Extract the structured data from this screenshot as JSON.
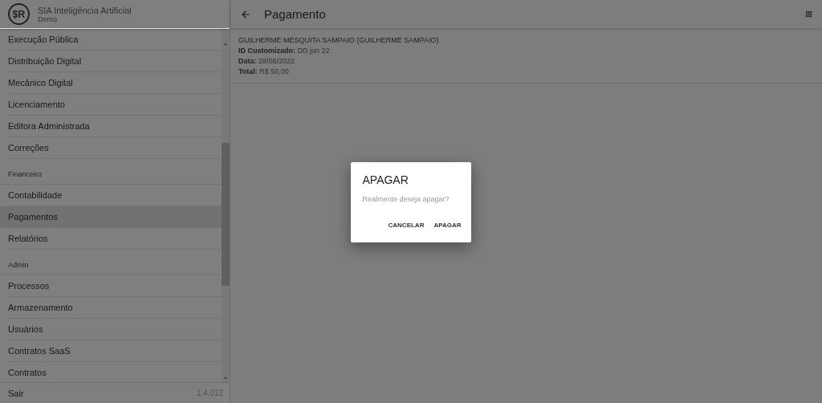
{
  "app": {
    "name": "SIA Inteligência Artificial",
    "subtitle": "Demo",
    "logo": "$R"
  },
  "menu": [
    {
      "kind": "item",
      "label": "Execução Pública",
      "selected": false
    },
    {
      "kind": "item",
      "label": "Distribuição Digital",
      "selected": false
    },
    {
      "kind": "item",
      "label": "Mecânico Digital",
      "selected": false
    },
    {
      "kind": "item",
      "label": "Licenciamento",
      "selected": false
    },
    {
      "kind": "item",
      "label": "Editora Administrada",
      "selected": false
    },
    {
      "kind": "item",
      "label": "Correções",
      "selected": false
    },
    {
      "kind": "heading",
      "label": "Financeiro"
    },
    {
      "kind": "item",
      "label": "Contabilidade",
      "selected": false
    },
    {
      "kind": "item",
      "label": "Pagamentos",
      "selected": true
    },
    {
      "kind": "item",
      "label": "Relatórios",
      "selected": false
    },
    {
      "kind": "heading",
      "label": "Admin"
    },
    {
      "kind": "item",
      "label": "Processos",
      "selected": false
    },
    {
      "kind": "item",
      "label": "Armazenamento",
      "selected": false
    },
    {
      "kind": "item",
      "label": "Usuários",
      "selected": false
    },
    {
      "kind": "item",
      "label": "Contratos SaaS",
      "selected": false
    },
    {
      "kind": "item",
      "label": "Contratos",
      "selected": false
    }
  ],
  "footer": {
    "logout": "Sair",
    "version": "1.4.012"
  },
  "page": {
    "title": "Pagamento"
  },
  "record": {
    "name": "GUILHERME MESQUITA SAMPAIO (GUILHERME SAMPAIO)",
    "fields": [
      {
        "label": "ID Customizado:",
        "value": "DD jun 22"
      },
      {
        "label": "Data:",
        "value": "28/06/2022"
      },
      {
        "label": "Total:",
        "value": "R$ 50,00"
      }
    ]
  },
  "dialog": {
    "title": "APAGAR",
    "message": "Realmente deseja apagar?",
    "buttons": [
      "CANCELAR",
      "APAGAR"
    ]
  }
}
